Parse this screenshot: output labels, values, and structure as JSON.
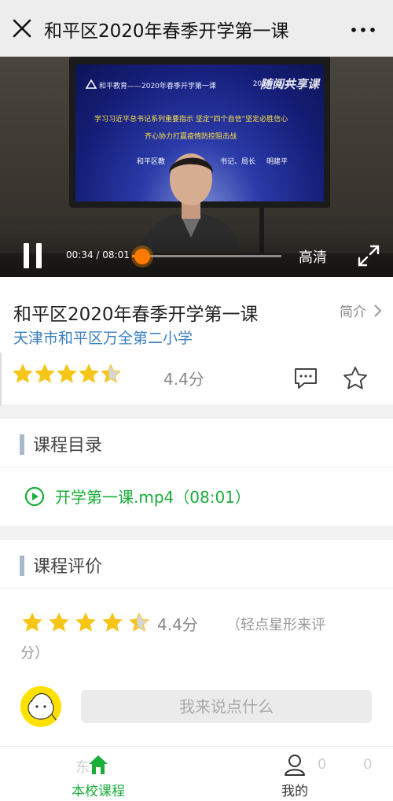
{
  "topbar": {
    "title": "和平区2020年春季开学第一课",
    "close_icon": "close-icon",
    "more_icon": "more-icon"
  },
  "video": {
    "screen_header": "和平教育——2020年春季开学第一课",
    "screen_date": "2020-02-10",
    "watermark": "随阅共享课",
    "screen_line1": "学习习近平总书记系列重要指示 坚定“四个自信”坚定必胜信心",
    "screen_line2": "齐心协力打赢疫情防控阻击战",
    "screen_line3_a": "和平区教",
    "screen_line3_b": "书记、局长",
    "screen_line3_c": "明建平",
    "current_time": "00:34",
    "duration": "08:01",
    "time_separator": " / ",
    "progress": 0.07,
    "quality": "高清"
  },
  "course": {
    "title": "和平区2020年春季开学第一课",
    "school": "天津市和平区万全第二小学",
    "intro_link": "简介",
    "rating": 4.4,
    "score_text": "4.4分"
  },
  "catalog": {
    "heading": "课程目录",
    "items": [
      {
        "name": "开学第一课.mp4（08:01）"
      }
    ]
  },
  "review": {
    "heading": "课程评价",
    "rating": 4.4,
    "score_text": "4.4分",
    "hint": "（轻点星形来评",
    "hint_cont": "分）",
    "input_placeholder": "我来说点什么"
  },
  "bottom_nav": {
    "ghost_left": "东",
    "ghost_left2": "",
    "ghost_count1": "0",
    "ghost_count2": "0",
    "home_label": "本校课程",
    "mine_label": "我的"
  },
  "colors": {
    "star": "#f5c518",
    "accent_green": "#1aad3a",
    "link_blue": "#3a7fc0",
    "progress_orange": "#ff7a00"
  }
}
